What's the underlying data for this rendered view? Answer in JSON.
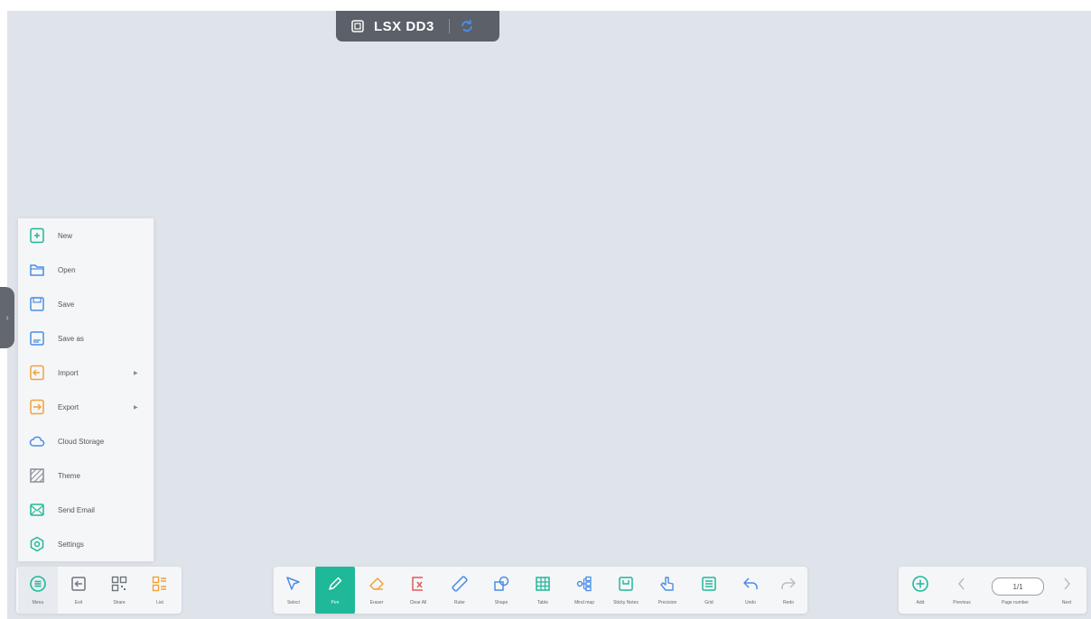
{
  "app": {
    "title": "LSX DD3",
    "title_icon": "document-icon",
    "sync_icon": "sync-icon"
  },
  "colors": {
    "canvas": "#dfe3ea",
    "accent_green": "#1fb898",
    "accent_orange": "#f2a23a",
    "accent_blue": "#4a8de6"
  },
  "menu": {
    "items": [
      {
        "label": "New",
        "icon": "new-file-icon"
      },
      {
        "label": "Open",
        "icon": "folder-open-icon"
      },
      {
        "label": "Save",
        "icon": "save-icon"
      },
      {
        "label": "Save as",
        "icon": "save-as-icon"
      },
      {
        "label": "Import",
        "icon": "import-icon",
        "submenu": true
      },
      {
        "label": "Export",
        "icon": "export-icon",
        "submenu": true
      },
      {
        "label": "Cloud Storage",
        "icon": "cloud-icon"
      },
      {
        "label": "Theme",
        "icon": "theme-icon"
      },
      {
        "label": "Send Email",
        "icon": "email-icon"
      },
      {
        "label": "Settings",
        "icon": "settings-icon"
      }
    ]
  },
  "left_toolbar": [
    {
      "label": "Menu",
      "icon": "menu-icon"
    },
    {
      "label": "Exit",
      "icon": "exit-icon"
    },
    {
      "label": "Share",
      "icon": "qr-code-icon"
    },
    {
      "label": "List",
      "icon": "list-icon"
    }
  ],
  "center_toolbar": [
    {
      "label": "Select",
      "icon": "select-cursor-icon"
    },
    {
      "label": "Pen",
      "icon": "pen-icon"
    },
    {
      "label": "Eraser",
      "icon": "eraser-icon"
    },
    {
      "label": "Clear All",
      "icon": "clear-all-icon"
    },
    {
      "label": "Ruler",
      "icon": "ruler-icon"
    },
    {
      "label": "Shape",
      "icon": "shape-icon"
    },
    {
      "label": "Table",
      "icon": "table-icon"
    },
    {
      "label": "Mind map",
      "icon": "mind-map-icon"
    },
    {
      "label": "Sticky Notes",
      "icon": "sticky-notes-icon"
    },
    {
      "label": "Precision",
      "icon": "precision-icon"
    },
    {
      "label": "Grid",
      "icon": "grid-icon"
    },
    {
      "label": "Undo",
      "icon": "undo-icon"
    },
    {
      "label": "Redo",
      "icon": "redo-icon"
    }
  ],
  "right_toolbar": {
    "add_label": "Add",
    "previous_label": "Previous",
    "page_value": "1/1",
    "page_label": "Page number",
    "next_label": "Next"
  }
}
